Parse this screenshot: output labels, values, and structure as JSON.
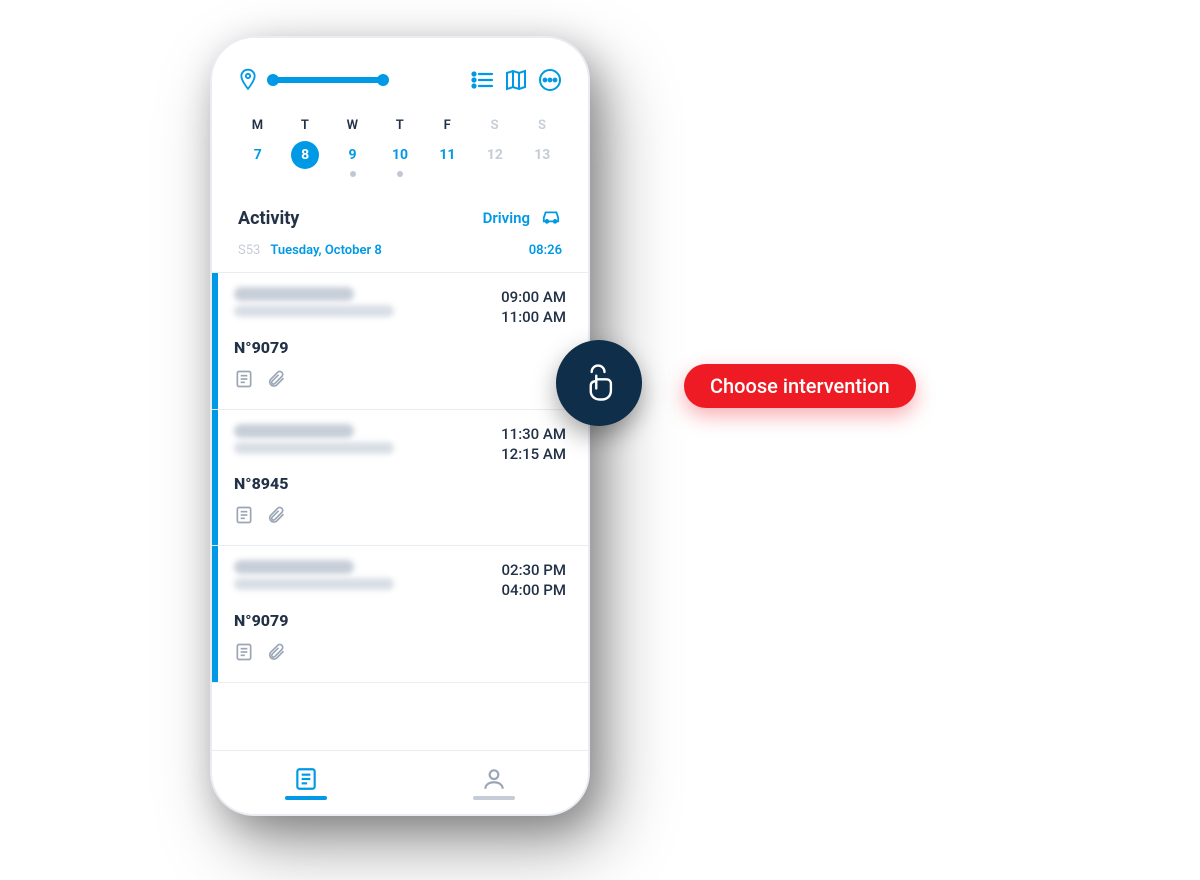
{
  "colors": {
    "accent": "#0099e5",
    "navy": "#0f2e4a",
    "red": "#ef1b24",
    "text": "#223146",
    "muted": "#c5ccd6"
  },
  "topbar": {
    "location_icon": "location-pin-icon",
    "actions": [
      "list-icon",
      "map-icon",
      "more-icon"
    ]
  },
  "calendar": {
    "weekdays": [
      "M",
      "T",
      "W",
      "T",
      "F",
      "S",
      "S"
    ],
    "dates": [
      "7",
      "8",
      "9",
      "10",
      "11",
      "12",
      "13"
    ],
    "selected_index": 1,
    "weekend_indices": [
      5,
      6
    ],
    "dot_indices": [
      2,
      3
    ]
  },
  "activity": {
    "title": "Activity",
    "status_label": "Driving",
    "status_icon": "car-icon",
    "week_code": "S53",
    "date_label": "Tuesday, October 8",
    "time_label": "08:26"
  },
  "cards": [
    {
      "ticket": "N°9079",
      "time_start": "09:00 AM",
      "time_end": "11:00 AM",
      "icons": [
        "note-icon",
        "attachment-icon"
      ]
    },
    {
      "ticket": "N°8945",
      "time_start": "11:30 AM",
      "time_end": "12:15 AM",
      "icons": [
        "note-icon",
        "attachment-icon"
      ]
    },
    {
      "ticket": "N°9079",
      "time_start": "02:30 PM",
      "time_end": "04:00 PM",
      "icons": [
        "note-icon",
        "attachment-icon"
      ]
    }
  ],
  "tabbar": {
    "items": [
      "task-list-icon",
      "profile-icon"
    ],
    "active_index": 0
  },
  "annotation": {
    "tap": "tap-gesture-icon",
    "callout": "Choose intervention"
  }
}
